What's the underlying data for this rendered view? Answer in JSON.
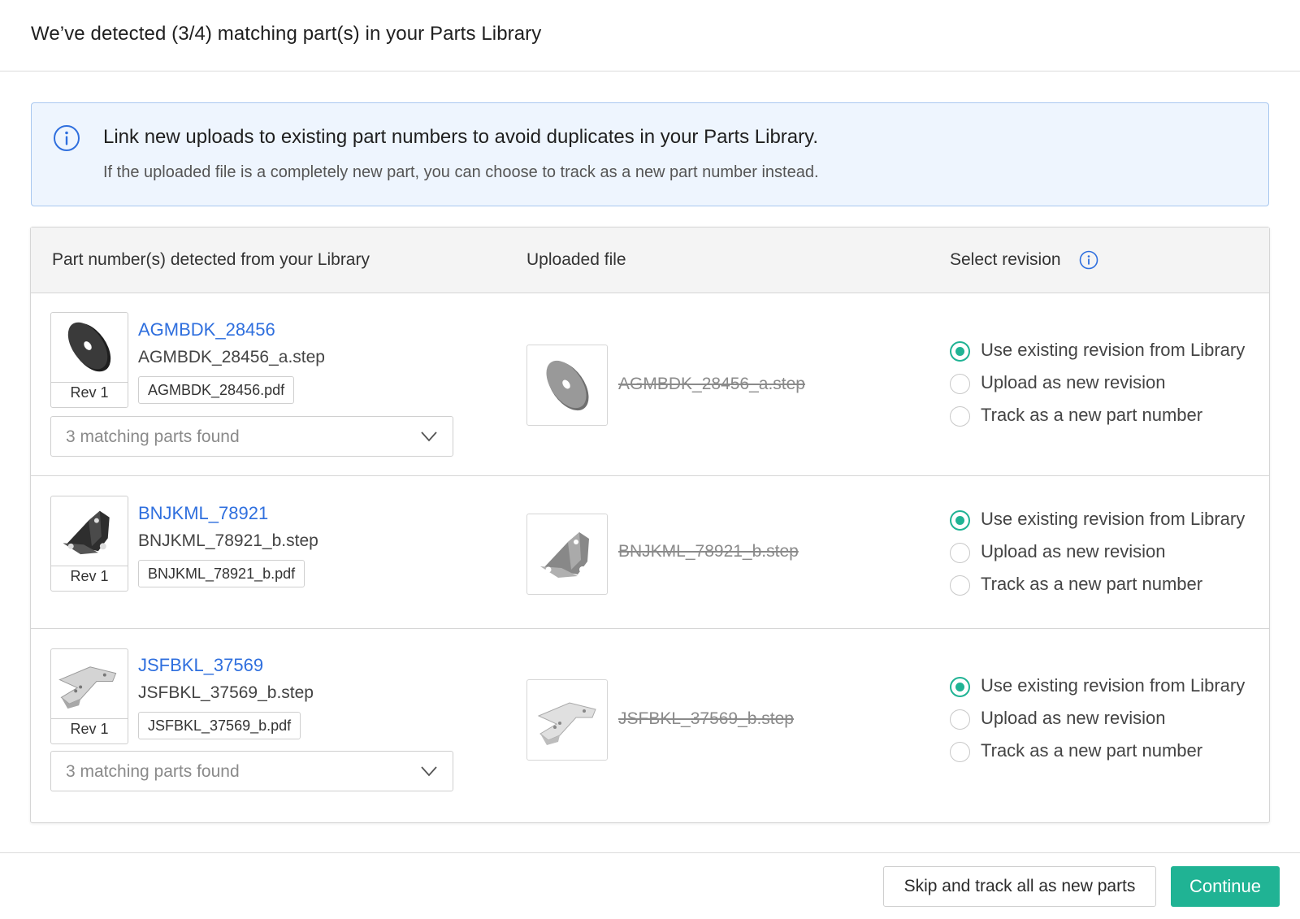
{
  "header": {
    "title": "We’ve detected (3/4) matching part(s) in your Parts Library"
  },
  "info_banner": {
    "icon": "info-icon",
    "title": "Link new uploads to existing part numbers to avoid duplicates in your Parts Library.",
    "subtitle": "If the uploaded file is a completely new part, you can choose to track as a new part number instead."
  },
  "table": {
    "headers": {
      "detected": "Part number(s) detected from your Library",
      "uploaded": "Uploaded file",
      "revision": "Select revision"
    },
    "rows": [
      {
        "part_number": "AGMBDK_28456",
        "step_file": "AGMBDK_28456_a.step",
        "pdf_file": "AGMBDK_28456.pdf",
        "rev": "Rev 1",
        "matching": "3 matching parts found",
        "uploaded_file": "AGMBDK_28456_a.step",
        "options": [
          "Use existing revision from Library",
          "Upload as new revision",
          "Track as a new part number"
        ],
        "selected": 0
      },
      {
        "part_number": "BNJKML_78921",
        "step_file": "BNJKML_78921_b.step",
        "pdf_file": "BNJKML_78921_b.pdf",
        "rev": "Rev 1",
        "matching": null,
        "uploaded_file": "BNJKML_78921_b.step",
        "options": [
          "Use existing revision from Library",
          "Upload as new revision",
          "Track as a new part number"
        ],
        "selected": 0
      },
      {
        "part_number": "JSFBKL_37569",
        "step_file": "JSFBKL_37569_b.step",
        "pdf_file": "JSFBKL_37569_b.pdf",
        "rev": "Rev 1",
        "matching": "3 matching parts found",
        "uploaded_file": "JSFBKL_37569_b.step",
        "options": [
          "Use existing revision from Library",
          "Upload as new revision",
          "Track as a new part number"
        ],
        "selected": 0
      }
    ]
  },
  "footer": {
    "skip_label": "Skip and track all as new parts",
    "continue_label": "Continue"
  },
  "colors": {
    "accent": "#20b394",
    "link": "#2f6fde",
    "info_bg": "#eef5fe",
    "info_border": "#a9c8f0"
  }
}
